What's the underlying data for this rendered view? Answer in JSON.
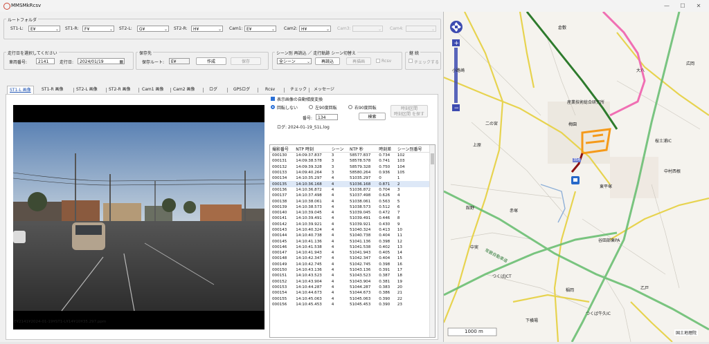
{
  "window": {
    "title": "MMSMkRcsv",
    "minimize": "—",
    "maximize": "☐",
    "close": "✕"
  },
  "route_folder": {
    "legend": "ルートフォルダ",
    "items": [
      {
        "label": "ST1-L:",
        "value": "E¥",
        "enabled": true
      },
      {
        "label": "ST1-R:",
        "value": "F¥",
        "enabled": true
      },
      {
        "label": "ST2-L:",
        "value": "G¥",
        "enabled": true
      },
      {
        "label": "ST2-R:",
        "value": "H¥",
        "enabled": true
      },
      {
        "label": "Cam1:",
        "value": "E¥",
        "enabled": true
      },
      {
        "label": "Cam2:",
        "value": "H¥",
        "enabled": true
      },
      {
        "label": "Cam3:",
        "value": "",
        "enabled": false
      },
      {
        "label": "Cam4:",
        "value": "",
        "enabled": false
      }
    ]
  },
  "run_select": {
    "legend": "走行日を選択してください",
    "vehicle_label": "車両番号:",
    "vehicle_value": "2141",
    "date_label": "走行日:",
    "date_value": "2024/01/19"
  },
  "save": {
    "legend": "保存先",
    "route_label": "保存ルート:",
    "route_value": "E¥",
    "create_button": "作成",
    "save_button": "保存"
  },
  "scene": {
    "legend": "シーン別 再読込 ／ 走行軌跡 シーン切替え",
    "scene_select": "全シーン",
    "reload_button": "再読込",
    "redraw_button": "再描画",
    "rcsv_label": "Rcsv"
  },
  "cont": {
    "legend": "継 続",
    "check_label": "チェックする"
  },
  "tabs": [
    "ST1-L 画像",
    "ST1-R 画像",
    "ST2-L 画像",
    "ST2-R 画像",
    "Cam1 画像",
    "Cam2 画像",
    "ログ",
    "GPSログ",
    "Rcsv",
    "チェック",
    "メッセージ"
  ],
  "image_opts": {
    "auto_rotate_label": "表示画像の自動傾度変換",
    "rotate_none": "回転しない",
    "rotate_left": "左90度回転",
    "rotate_right": "右90度回転",
    "time_search_button": "時刻区間\n時刻区間 を探す",
    "number_label": "番号:",
    "number_value": "134",
    "search_button": "検索",
    "log_label": "ログ: 2024-01-19_S1L.log"
  },
  "image_caption": "E¥2141¥2024-01-19¥ST1-L¥14¥10¥35.297.ppm",
  "table": {
    "columns": [
      "撮影番号",
      "NTP 時刻",
      "シーン",
      "NTP 秒",
      "時刻差",
      "シーン別番号"
    ],
    "selected_index": 5,
    "rows": [
      [
        "000130",
        "14:09:37.837",
        "3",
        "58577.837",
        "0.734",
        "102"
      ],
      [
        "000131",
        "14:09:38.578",
        "3",
        "58578.578",
        "0.741",
        "103"
      ],
      [
        "000132",
        "14:09:39.328",
        "3",
        "58579.328",
        "0.750",
        "104"
      ],
      [
        "000133",
        "14:09:40.264",
        "3",
        "58580.264",
        "0.936",
        "105"
      ],
      [
        "000134",
        "14:10:35.297",
        "4",
        "51035.297",
        "0",
        "1"
      ],
      [
        "000135",
        "14:10:36.168",
        "4",
        "51036.168",
        "0.871",
        "2"
      ],
      [
        "000136",
        "14:10:36.872",
        "4",
        "51036.872",
        "0.704",
        "3"
      ],
      [
        "000137",
        "14:10:37.498",
        "4",
        "51037.498",
        "0.626",
        "4"
      ],
      [
        "000138",
        "14:10:38.061",
        "4",
        "51038.061",
        "0.563",
        "5"
      ],
      [
        "000139",
        "14:10:38.573",
        "4",
        "51038.573",
        "0.512",
        "6"
      ],
      [
        "000140",
        "14:10:39.045",
        "4",
        "51039.045",
        "0.472",
        "7"
      ],
      [
        "000141",
        "14:10:39.491",
        "4",
        "51039.491",
        "0.446",
        "8"
      ],
      [
        "000142",
        "14:10:39.921",
        "4",
        "51039.921",
        "0.430",
        "9"
      ],
      [
        "000143",
        "14:10:40.324",
        "4",
        "51040.324",
        "0.413",
        "10"
      ],
      [
        "000144",
        "14:10:40.738",
        "4",
        "51040.738",
        "0.404",
        "11"
      ],
      [
        "000145",
        "14:10:41.136",
        "4",
        "51041.136",
        "0.398",
        "12"
      ],
      [
        "000146",
        "14:10:41.538",
        "4",
        "51041.538",
        "0.402",
        "13"
      ],
      [
        "000147",
        "14:10:41.943",
        "4",
        "51041.943",
        "0.405",
        "14"
      ],
      [
        "000148",
        "14:10:42.347",
        "4",
        "51042.347",
        "0.404",
        "15"
      ],
      [
        "000149",
        "14:10:42.745",
        "4",
        "51042.745",
        "0.398",
        "16"
      ],
      [
        "000150",
        "14:10:43.136",
        "4",
        "51043.136",
        "0.391",
        "17"
      ],
      [
        "000151",
        "14:10:43.523",
        "4",
        "51043.523",
        "0.387",
        "18"
      ],
      [
        "000152",
        "14:10:43.904",
        "4",
        "51043.904",
        "0.381",
        "19"
      ],
      [
        "000153",
        "14:10:44.287",
        "4",
        "51044.287",
        "0.383",
        "20"
      ],
      [
        "000154",
        "14:10:44.673",
        "4",
        "51044.673",
        "0.386",
        "21"
      ],
      [
        "000155",
        "14:10:45.063",
        "4",
        "51045.063",
        "0.390",
        "22"
      ],
      [
        "000156",
        "14:10:45.453",
        "4",
        "51045.453",
        "0.390",
        "23"
      ]
    ]
  },
  "map": {
    "labels": [
      {
        "text": "倉敷"
      },
      {
        "text": "大八"
      },
      {
        "text": "広岡"
      },
      {
        "text": "小路崎"
      },
      {
        "text": "産業技術総合研究所"
      },
      {
        "text": "二の宮"
      },
      {
        "text": "梅園"
      },
      {
        "text": "上原"
      },
      {
        "text": "桜土浦IC"
      },
      {
        "text": "中村西根"
      },
      {
        "text": "東平塚"
      },
      {
        "text": "赤塚"
      },
      {
        "text": "館野"
      },
      {
        "text": "谷田部東PA"
      },
      {
        "text": "中実"
      },
      {
        "text": "常磐自動車道"
      },
      {
        "text": "つくばJCT"
      },
      {
        "text": "稲岡"
      },
      {
        "text": "乙戸"
      },
      {
        "text": "下横場"
      },
      {
        "text": "つくば牛久IC"
      }
    ],
    "scale": "1000 m",
    "attribution": "国土地理院",
    "route_number": "354"
  }
}
